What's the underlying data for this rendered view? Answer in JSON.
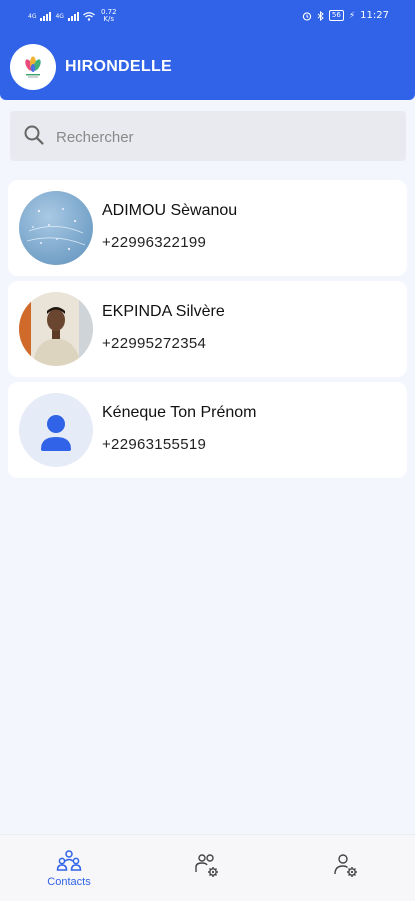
{
  "status_bar": {
    "network_left": "4G",
    "network_right": "4G",
    "net_speed_value": "0.72",
    "net_speed_unit": "K/s",
    "battery": "56",
    "time": "11:27"
  },
  "app": {
    "title": "HIRONDELLE"
  },
  "search": {
    "placeholder": "Rechercher"
  },
  "contacts": [
    {
      "name": "ADIMOU Sèwanou",
      "phone": "+22996322199"
    },
    {
      "name": "EKPINDA Silvère",
      "phone": "+22995272354"
    },
    {
      "name": "Kéneque Ton Prénom",
      "phone": "+22963155519"
    }
  ],
  "bottom_nav": {
    "items": [
      {
        "label": "Contacts",
        "icon": "contacts-icon",
        "active": true
      },
      {
        "label": "",
        "icon": "groups-settings-icon",
        "active": false
      },
      {
        "label": "",
        "icon": "account-settings-icon",
        "active": false
      }
    ]
  },
  "colors": {
    "primary": "#3063e7",
    "background": "#f3f6fc",
    "card": "#ffffff"
  }
}
